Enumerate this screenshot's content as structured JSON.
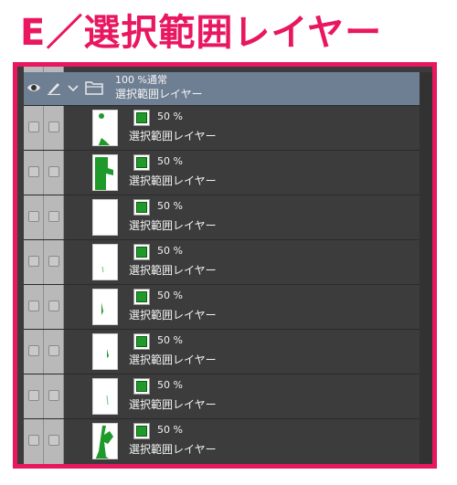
{
  "title": "E／選択範囲レイヤー",
  "colors": {
    "accent": "#e8175f",
    "selection_green": "#1f9a2a",
    "header_bg": "#6f7f93",
    "panel_bg": "#3c3c3c"
  },
  "header": {
    "opacity": "100 %",
    "blend_mode": "通常",
    "opacity_line": "100 %通常",
    "name": "選択範囲レイヤー",
    "icons": [
      "eye-icon",
      "pen-icon",
      "chevron-down-icon",
      "folder-icon"
    ]
  },
  "layers": [
    {
      "opacity": "50 %",
      "name": "選択範囲レイヤー"
    },
    {
      "opacity": "50 %",
      "name": "選択範囲レイヤー"
    },
    {
      "opacity": "50 %",
      "name": "選択範囲レイヤー"
    },
    {
      "opacity": "50 %",
      "name": "選択範囲レイヤー"
    },
    {
      "opacity": "50 %",
      "name": "選択範囲レイヤー"
    },
    {
      "opacity": "50 %",
      "name": "選択範囲レイヤー"
    },
    {
      "opacity": "50 %",
      "name": "選択範囲レイヤー"
    },
    {
      "opacity": "50 %",
      "name": "選択範囲レイヤー"
    }
  ]
}
